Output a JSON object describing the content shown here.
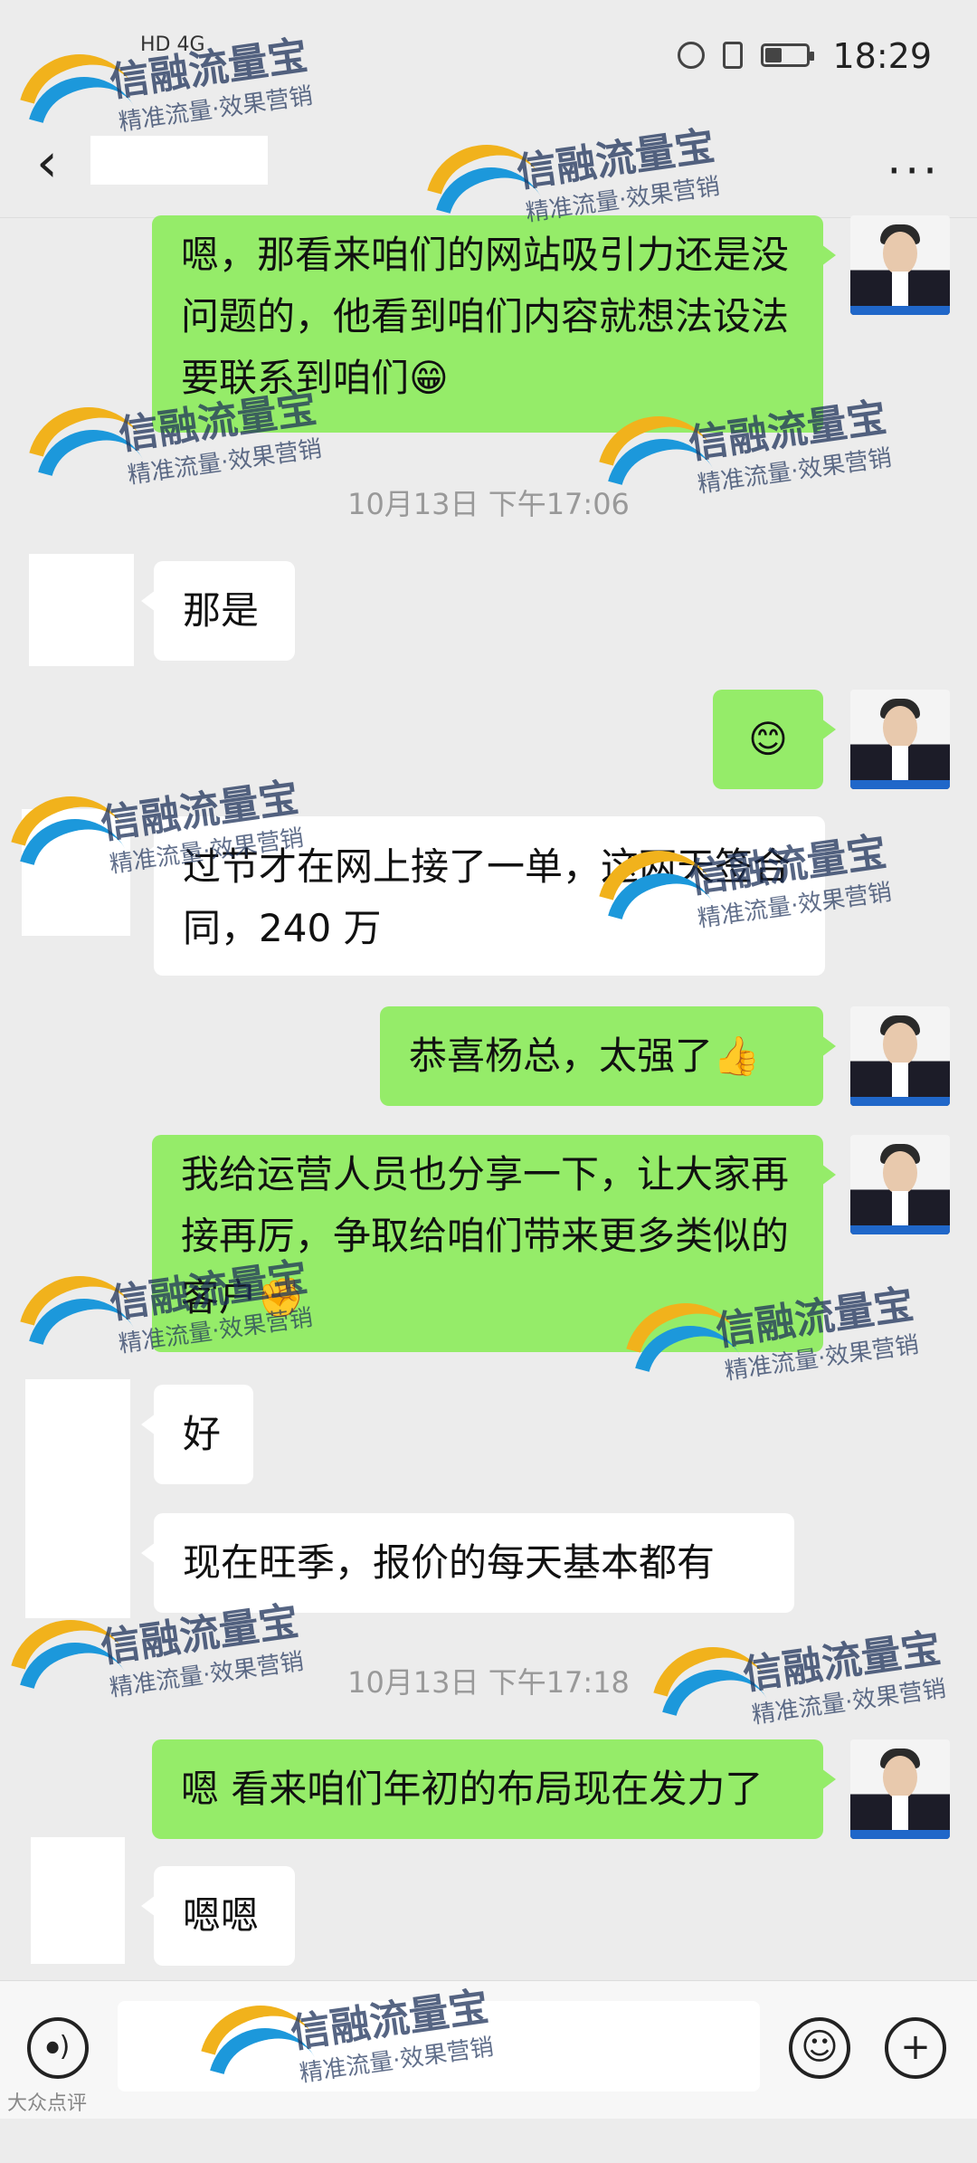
{
  "statusbar": {
    "network": "HD 4G",
    "time": "18:29",
    "battery_level": 0.4
  },
  "nav": {
    "back_icon": "chevron-left-icon",
    "more_label": "···"
  },
  "messages": [
    {
      "side": "me",
      "text": "嗯，那看来咱们的网站吸引力还是没问题的，他看到咱们内容就想法设法要联系到咱们😁"
    },
    {
      "side": "them",
      "text": "那是"
    },
    {
      "side": "me",
      "text": "😊"
    },
    {
      "side": "them",
      "text": "过节才在网上接了一单，这两天签合同，240 万"
    },
    {
      "side": "me",
      "text": "恭喜杨总，太强了👍"
    },
    {
      "side": "me",
      "text": "我给运营人员也分享一下，让大家再接再厉，争取给咱们带来更多类似的客户✊"
    },
    {
      "side": "them",
      "text": "好"
    },
    {
      "side": "them",
      "text": "现在旺季，报价的每天基本都有"
    },
    {
      "side": "me",
      "text": "嗯 看来咱们年初的布局现在发力了"
    },
    {
      "side": "them",
      "text": "嗯嗯"
    }
  ],
  "timestamps": [
    "10月13日 下午17:06",
    "10月13日 下午17:18"
  ],
  "watermark": {
    "brand": "信融流量宝",
    "slogan": "精准流量·效果营销"
  },
  "bottombar": {
    "voice_icon": "voice-icon",
    "emoji_icon": "emoji-icon",
    "plus_icon": "plus-icon"
  },
  "footer_mark": "大众点评"
}
